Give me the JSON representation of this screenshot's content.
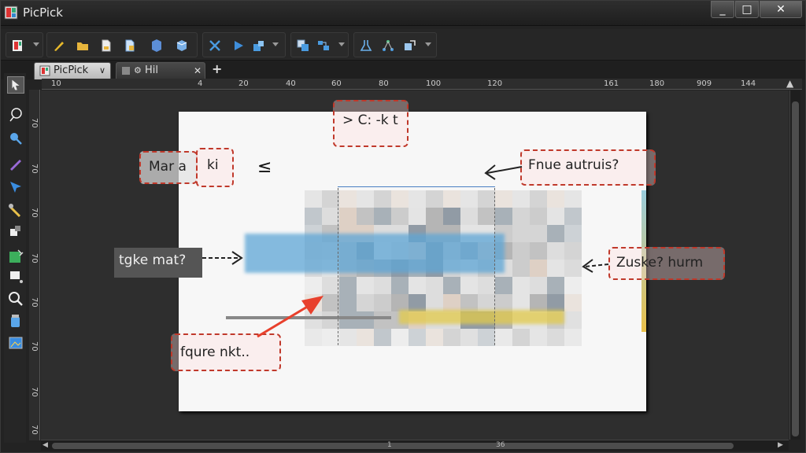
{
  "window": {
    "title": "PicPick",
    "minimize": "_",
    "maximize": "□",
    "close": "✕"
  },
  "tabs": [
    {
      "label": "PicPick"
    },
    {
      "label": "Hil"
    }
  ],
  "tab_add": "+",
  "ruler_h": [
    "10",
    "4",
    "20",
    "40",
    "60",
    "80",
    "100",
    "120",
    "161",
    "180",
    "909",
    "144"
  ],
  "ruler_v": [
    "70",
    "70",
    "70",
    "70",
    "70",
    "70",
    "70",
    "70"
  ],
  "hscroll_marks": [
    "1",
    "36"
  ],
  "canvas": {
    "top_callout": "> C: -k t",
    "callout_left": "Mar a",
    "callout_left2": "ki",
    "symbol": "≤",
    "callout_right": "Fnue autruis?",
    "dark_label": "tgke mat?",
    "callout_right2": "Zuske? hurm",
    "callout_bottom": "fqure nkt.."
  },
  "colors": {
    "accent": "#c0392b",
    "arrow_red": "#e8402c",
    "blue_band": "#5ea6d6",
    "yellow_band": "#e2c94a"
  }
}
